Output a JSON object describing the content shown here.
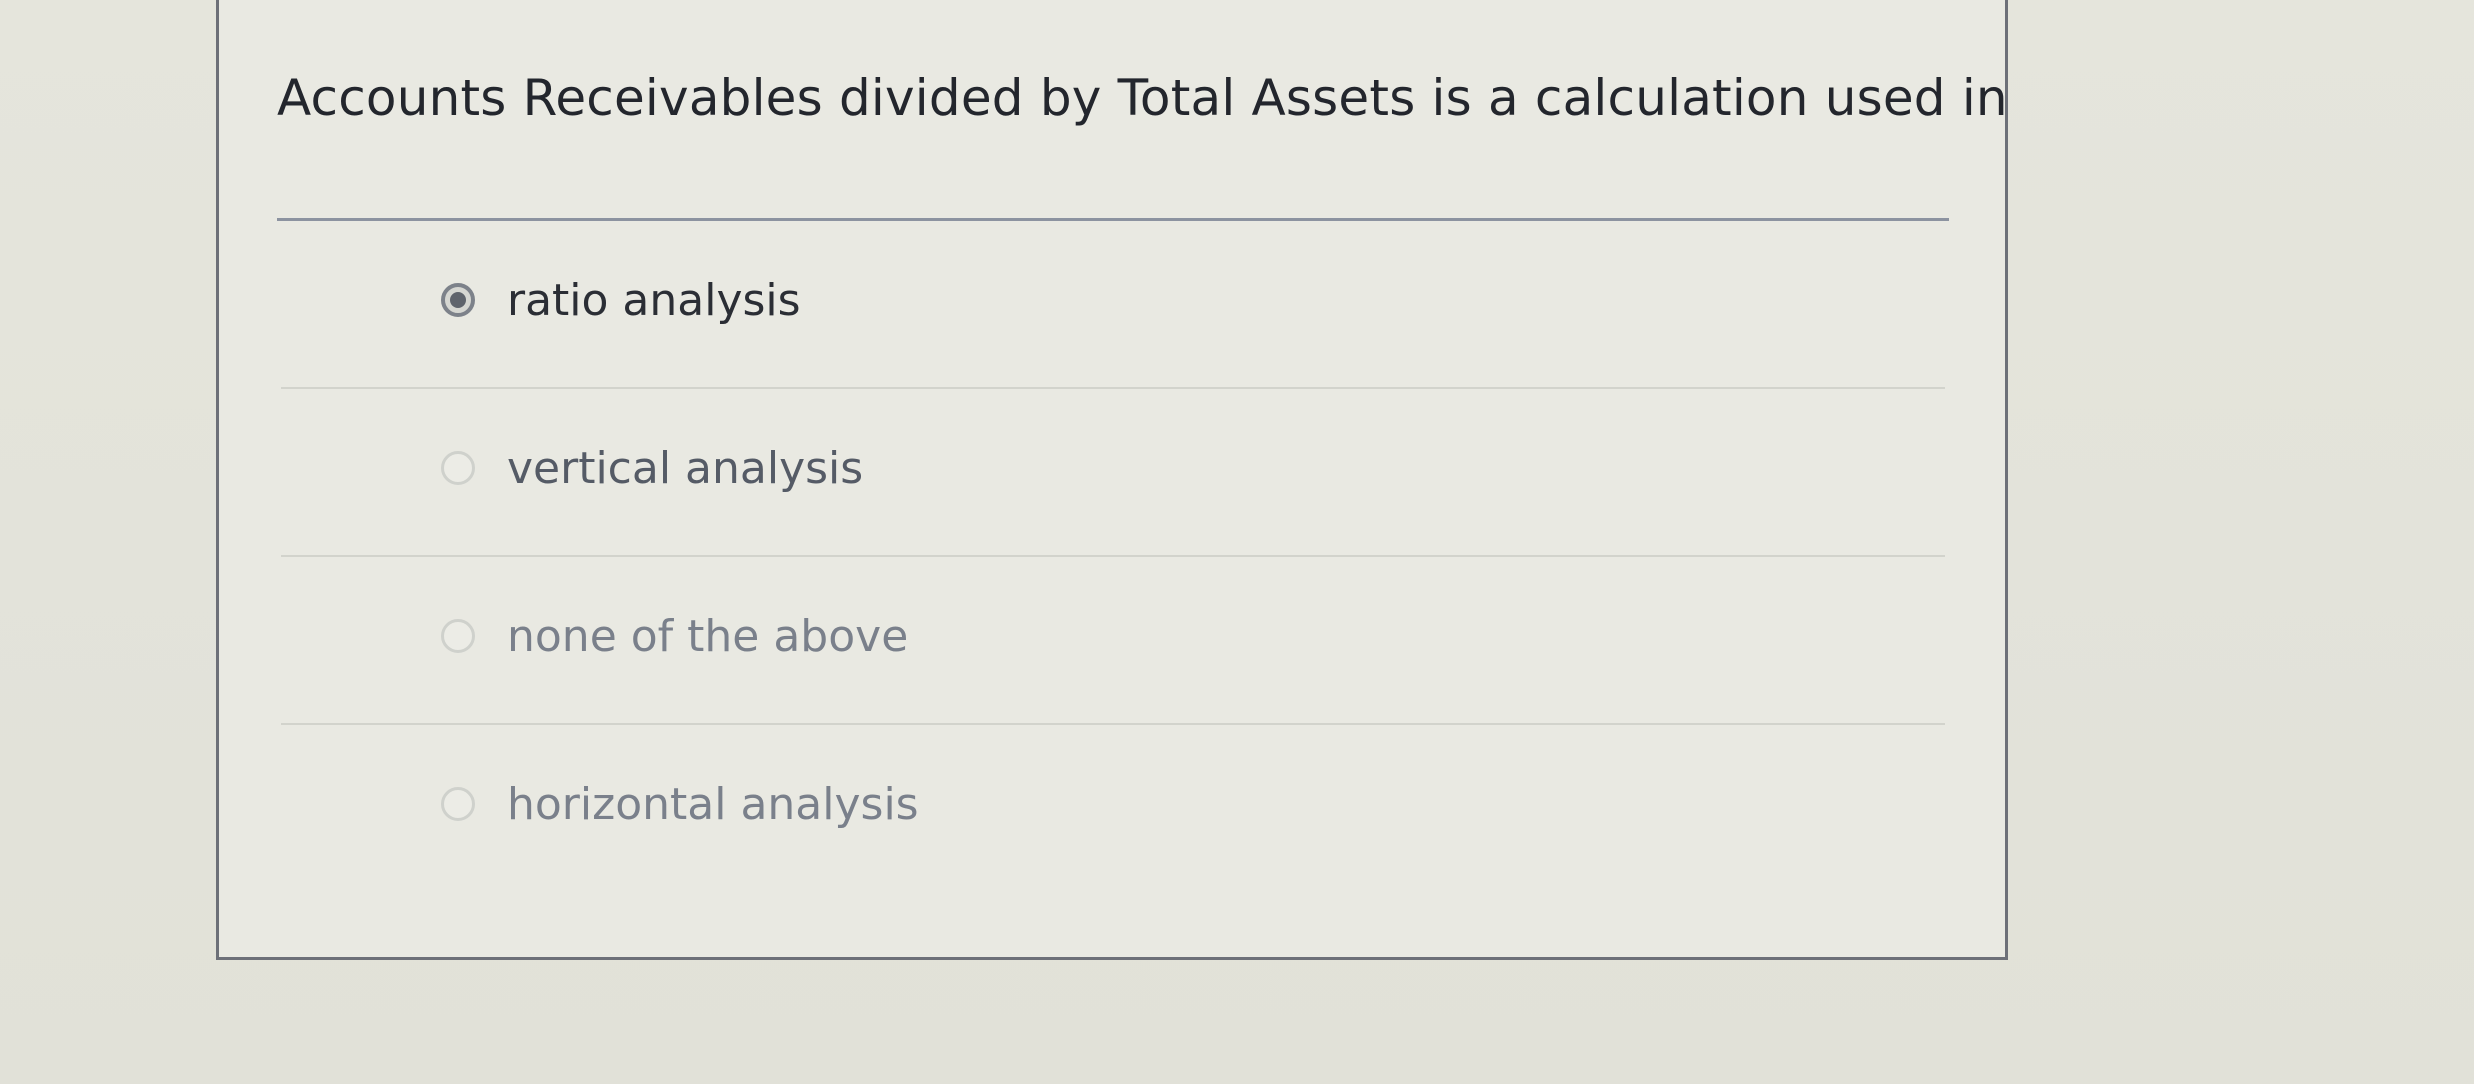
{
  "question": {
    "text": "Accounts Receivables divided by Total Assets is a calculation used in"
  },
  "answers": [
    {
      "label": "ratio analysis",
      "selected": true
    },
    {
      "label": "vertical analysis",
      "selected": false
    },
    {
      "label": "none of the above",
      "selected": false
    },
    {
      "label": "horizontal analysis",
      "selected": false
    }
  ]
}
